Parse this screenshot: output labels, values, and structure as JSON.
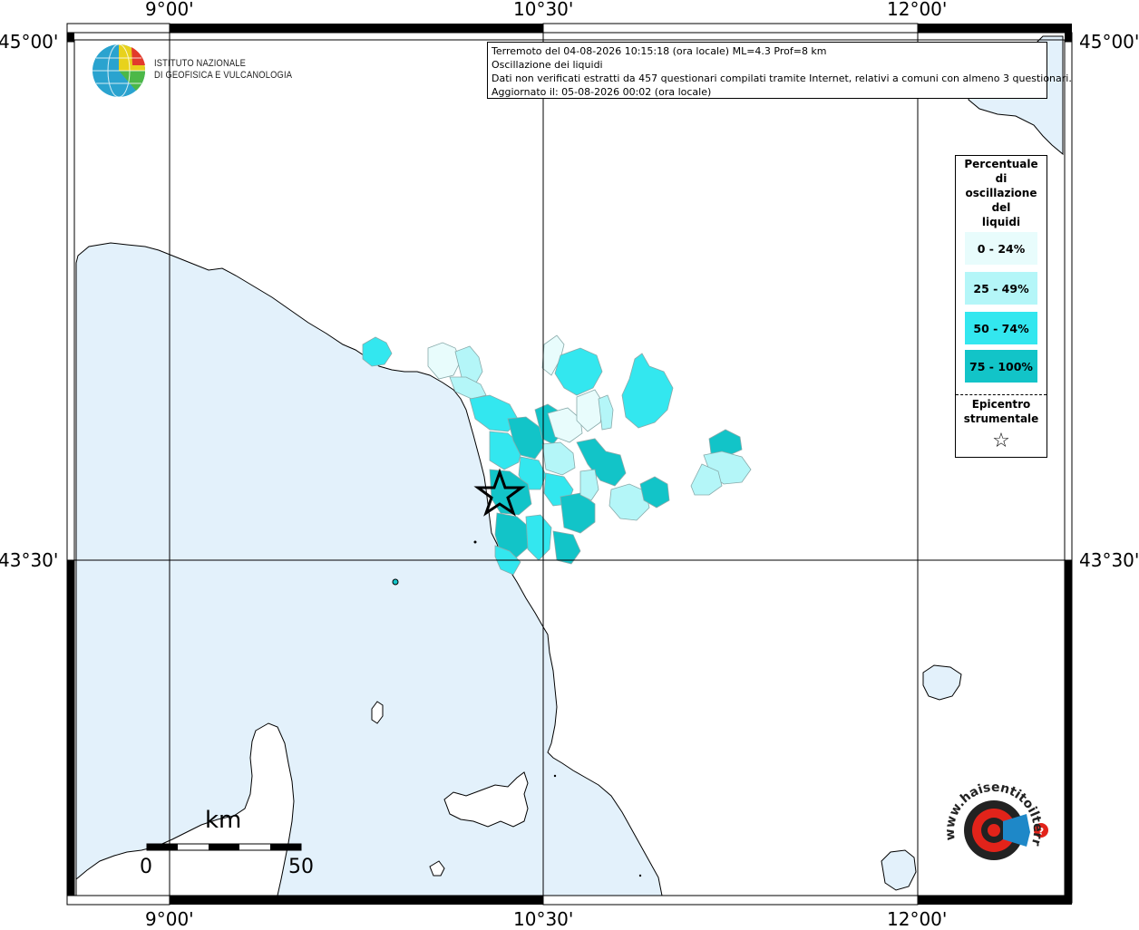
{
  "map": {
    "info": {
      "line1": "Terremoto del 04-08-2026 10:15:18 (ora locale) ML=4.3 Prof=8 km",
      "line2": "Oscillazione dei liquidi",
      "line3": "Dati non verificati estratti da 457 questionari compilati tramite Internet, relativi a comuni con almeno 3 questionari.",
      "line4": "Aggiornato il: 05-08-2026 00:02 (ora locale)"
    },
    "institute": {
      "line1": "ISTITUTO NAZIONALE",
      "line2": "DI GEOFISICA E VULCANOLOGIA"
    },
    "coords": {
      "top_left_lon": "9°00'",
      "top_mid_lon": "10°30'",
      "top_right_lon": "12°00'",
      "bottom_left_lon": "9°00'",
      "bottom_mid_lon": "10°30'",
      "bottom_right_lon": "12°00'",
      "left_top_lat": "45°00'",
      "left_mid_lat": "43°30'",
      "right_top_lat": "45°00'",
      "right_mid_lat": "43°30'"
    },
    "legend": {
      "title": "Percentuale di oscillazione del liquidi",
      "title_lines": [
        "Percentuale",
        "di",
        "oscillazione",
        "del",
        "liquidi"
      ],
      "classes": [
        {
          "label": "0 - 24%",
          "color": "#e8fcfc"
        },
        {
          "label": "25 - 49%",
          "color": "#b4f6f8"
        },
        {
          "label": "50 - 74%",
          "color": "#33e7ef"
        },
        {
          "label": "75 - 100%",
          "color": "#12c4c8"
        }
      ],
      "epicenter_lines": [
        "Epicentro",
        "strumentale"
      ],
      "epicenter_icon": "star-outline-icon"
    },
    "scale": {
      "unit": "km",
      "min": "0",
      "max": "50"
    },
    "badge": {
      "text": "www.haisentitoilterremoto.it",
      "colors": {
        "red": "#e2231a",
        "blue": "#1e88c8",
        "dark": "#222222"
      }
    },
    "colors": {
      "sea": "#e3f1fb",
      "land": "#ffffff",
      "frame": "#000000"
    }
  }
}
